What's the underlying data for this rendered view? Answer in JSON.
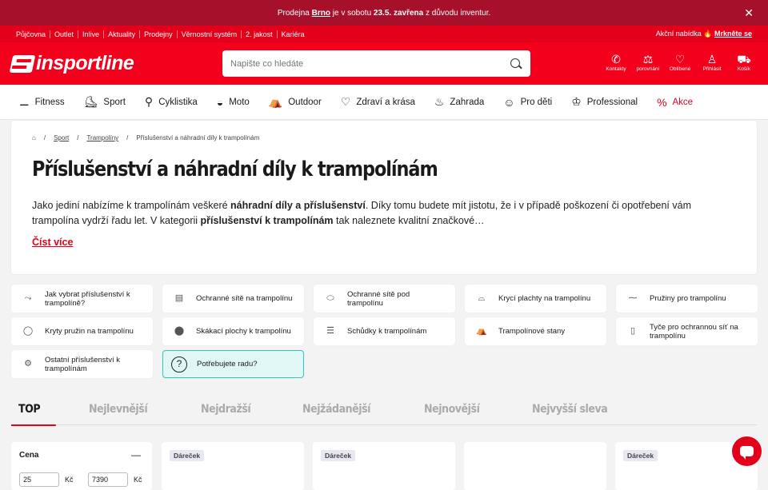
{
  "announcement": {
    "pre": "Prodejna ",
    "city": "Brno",
    "mid": " je v sobotu ",
    "date": "23.5.",
    "bold2": "zavřena",
    "post": " z důvodu inventur.",
    "close": "✕"
  },
  "topnav": {
    "links": [
      "Půjčovna",
      "Outlet",
      "Inlive",
      "Aktuality",
      "Prodejny",
      "Věrnostní systém",
      "2. jakost",
      "Kariéra"
    ],
    "offer_label": "Akční nabídka 🔥",
    "offer_link": "Mrkněte se"
  },
  "header": {
    "logo": "insportline",
    "search_placeholder": "Napište co hledáte",
    "icons": [
      {
        "label": "Kontakty",
        "icon": "phone-icon",
        "glyph": "✆"
      },
      {
        "label": "porovnání",
        "icon": "scale-icon",
        "glyph": "⚖"
      },
      {
        "label": "Oblíbené",
        "icon": "heart-icon",
        "glyph": "♡"
      },
      {
        "label": "Přihlásit",
        "icon": "user-icon",
        "glyph": "♙"
      },
      {
        "label": "Košík",
        "icon": "cart-icon",
        "glyph": "⛟"
      }
    ]
  },
  "categories": [
    {
      "label": "Fitness",
      "icon": "fitness-icon",
      "glyph": "⚊"
    },
    {
      "label": "Sport",
      "icon": "skate-icon",
      "glyph": "⛸"
    },
    {
      "label": "Cyklistika",
      "icon": "bike-icon",
      "glyph": "⚲"
    },
    {
      "label": "Moto",
      "icon": "helmet-icon",
      "glyph": "◒"
    },
    {
      "label": "Outdoor",
      "icon": "tent-icon",
      "glyph": "⛺"
    },
    {
      "label": "Zdraví a krása",
      "icon": "heart-hand-icon",
      "glyph": "♡"
    },
    {
      "label": "Zahrada",
      "icon": "grill-icon",
      "glyph": "♨"
    },
    {
      "label": "Pro děti",
      "icon": "child-icon",
      "glyph": "☺"
    },
    {
      "label": "Professional",
      "icon": "medal-icon",
      "glyph": "♔"
    },
    {
      "label": "Akce",
      "icon": "percent-icon",
      "glyph": "%"
    }
  ],
  "breadcrumb": {
    "home_icon": "⌂",
    "items": [
      "Sport",
      "Trampolíny",
      "Příslušenství a náhradní díly k trampolínám"
    ],
    "sep": "/"
  },
  "page": {
    "title": "Příslušenství a náhradní díly k trampolínám",
    "desc_1": "Jako jediní nabízíme k trampolínám veškeré ",
    "desc_b1": "náhradní díly a příslušenství",
    "desc_2": ". Díky tomu budete mít jistotu, že i v případě poškození či opotřebení vám trampolína vydrží řadu let. V kategorii ",
    "desc_b2": "příslušenství k trampolínám",
    "desc_3": " tak naleznete kvalitní značkové…",
    "read_more": "Číst více"
  },
  "tiles": [
    {
      "label": "Jak vybrat příslušenství k trampolíně?",
      "glyph": "⤳"
    },
    {
      "label": "Ochranné sítě na trampolínu",
      "glyph": "▤"
    },
    {
      "label": "Ochranné sítě pod trampolínu",
      "glyph": "⬭"
    },
    {
      "label": "Krycí plachty na trampolínu",
      "glyph": "⌓"
    },
    {
      "label": "Pružiny pro trampolínu",
      "glyph": "⁓"
    },
    {
      "label": "Kryty pružin na trampolínu",
      "glyph": "◯"
    },
    {
      "label": "Skákací plochy k trampolínu",
      "glyph": "⬤"
    },
    {
      "label": "Schůdky k trampolínám",
      "glyph": "☰"
    },
    {
      "label": "Trampolínové stany",
      "glyph": "⛺"
    },
    {
      "label": "Tyče pro ochrannou síť na trampolínu",
      "glyph": "▯"
    },
    {
      "label": "Ostatní příslušenství k trampolínám",
      "glyph": "⚙"
    },
    {
      "label": "Potřebujete radu?",
      "glyph": "?"
    }
  ],
  "sort_tabs": [
    "TOP",
    "Nejlevnější",
    "Nejdražší",
    "Nejžádanější",
    "Nejnovější",
    "Nejvyšší sleva"
  ],
  "filter": {
    "title": "Cena",
    "toggle": "—",
    "min": "25",
    "max": "7390",
    "unit": "Kč"
  },
  "products": [
    {
      "badge": "Dáreček"
    },
    {
      "badge": "Dáreček"
    },
    {
      "badge": ""
    },
    {
      "badge": "Dáreček"
    }
  ],
  "colors": {
    "brand": "#e2001a",
    "topbar": "#a6102a",
    "help_bg": "#e0f7f5"
  }
}
